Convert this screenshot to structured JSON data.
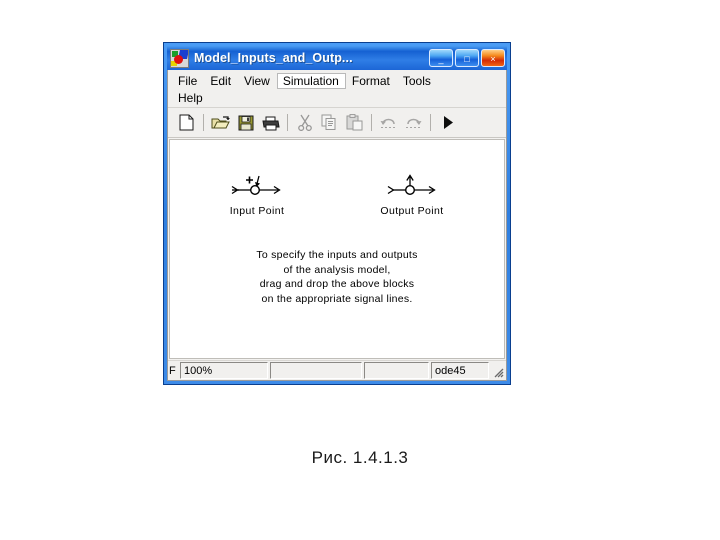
{
  "window": {
    "title": "Model_Inputs_and_Outp...",
    "icon": "simulink-library-icon",
    "controls": {
      "minimize": "_",
      "maximize": "□",
      "close": "×"
    }
  },
  "menu": {
    "row1": [
      {
        "label": "File",
        "highlighted": false
      },
      {
        "label": "Edit",
        "highlighted": false
      },
      {
        "label": "View",
        "highlighted": false
      },
      {
        "label": "Simulation",
        "highlighted": true
      },
      {
        "label": "Format",
        "highlighted": false
      },
      {
        "label": "Tools",
        "highlighted": false
      }
    ],
    "row2": [
      {
        "label": "Help",
        "highlighted": false
      }
    ]
  },
  "toolbar": {
    "buttons": [
      {
        "name": "new-model-icon",
        "title": "New model",
        "enabled": true
      },
      {
        "name": "open-model-icon",
        "title": "Open model",
        "enabled": true
      },
      {
        "name": "save-model-icon",
        "title": "Save model",
        "enabled": true
      },
      {
        "name": "print-icon",
        "title": "Print",
        "enabled": true
      },
      {
        "name": "cut-icon",
        "title": "Cut",
        "enabled": false
      },
      {
        "name": "copy-icon",
        "title": "Copy",
        "enabled": false
      },
      {
        "name": "paste-icon",
        "title": "Paste",
        "enabled": false
      },
      {
        "name": "undo-icon",
        "title": "Undo",
        "enabled": false
      },
      {
        "name": "redo-icon",
        "title": "Redo",
        "enabled": false
      },
      {
        "name": "start-simulation-icon",
        "title": "Start simulation",
        "enabled": true
      }
    ]
  },
  "canvas": {
    "blocks": [
      {
        "id": "input-point",
        "label": "Input Point",
        "glyph": "input-point-block-icon"
      },
      {
        "id": "output-point",
        "label": "Output Point",
        "glyph": "output-point-block-icon"
      }
    ],
    "hint_lines": [
      "To specify the inputs and outputs",
      "of the analysis model,",
      "drag and drop the above blocks",
      "on the appropriate signal lines."
    ]
  },
  "statusbar": {
    "ready": "F",
    "zoom": "100%",
    "field2": "",
    "field3": "",
    "solver": "ode45",
    "grip": "resize-grip-icon"
  },
  "figure": {
    "caption": "Рис. 1.4.1.3"
  },
  "colors": {
    "title_gradient_start": "#4a9bf2",
    "title_gradient_end": "#1c66d6",
    "frame_border": "#0a3f8f",
    "close_button": "#d32b06",
    "canvas_bg": "#ffffff",
    "chrome_bg": "#f1f0ee"
  }
}
